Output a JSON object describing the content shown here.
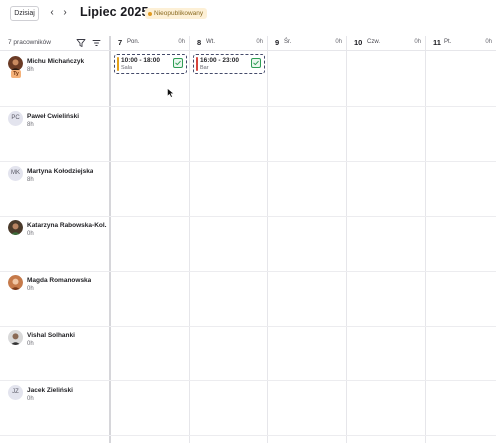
{
  "toolbar": {
    "today_label": "Dzisiaj",
    "prev_icon": "chevron-left-icon",
    "next_icon": "chevron-right-icon",
    "month_title": "Lipiec 2025",
    "status_label": "Nieopublikowany",
    "status_color": "#e39b21"
  },
  "header": {
    "employee_count_label": "7 pracowników",
    "filter_icon": "filter-icon",
    "sort_icon": "sort-icon"
  },
  "days": [
    {
      "num": "7",
      "name": "Pon.",
      "hours": "0h"
    },
    {
      "num": "8",
      "name": "Wt.",
      "hours": "0h"
    },
    {
      "num": "9",
      "name": "Śr.",
      "hours": "0h"
    },
    {
      "num": "10",
      "name": "Czw.",
      "hours": "0h"
    },
    {
      "num": "11",
      "name": "Pt.",
      "hours": "0h"
    }
  ],
  "employees": [
    {
      "name": "Michu Michańczyk",
      "hours": "8h",
      "initials": "",
      "you_badge": "Ty"
    },
    {
      "name": "Paweł Ćwieliński",
      "hours": "8h",
      "initials": "PC"
    },
    {
      "name": "Martyna Kołodziejska",
      "hours": "8h",
      "initials": "MK"
    },
    {
      "name": "Katarzyna Rabowska-Kol...",
      "hours": "0h",
      "initials": ""
    },
    {
      "name": "Magda Romanowska",
      "hours": "0h",
      "initials": ""
    },
    {
      "name": "Vishal Solhanki",
      "hours": "0h",
      "initials": ""
    },
    {
      "name": "Jacek Zieliński",
      "hours": "0h",
      "initials": "JZ"
    }
  ],
  "shifts": [
    {
      "time": "10:00 - 18:00",
      "location": "Sala",
      "color": "#e3a21a"
    },
    {
      "time": "16:00 - 23:00",
      "location": "Bar",
      "color": "#d6453d"
    }
  ]
}
